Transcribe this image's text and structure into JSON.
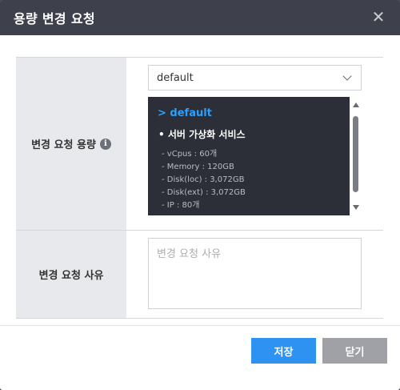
{
  "modal": {
    "title": "용량 변경 요청",
    "close_glyph": "✕"
  },
  "form": {
    "capacity_label": "변경 요청 용량",
    "info_glyph": "i",
    "select_value": "default",
    "spec": {
      "head": "> default",
      "subtitle": "• 서버 가상화 서비스",
      "items": [
        "- vCpus : 60개",
        "- Memory : 120GB",
        "- Disk(loc) : 3,072GB",
        "- Disk(ext) : 3,072GB",
        "- IP : 80개"
      ]
    },
    "reason_label": "변경 요청 사유",
    "reason_placeholder": "변경 요청 사유"
  },
  "buttons": {
    "save_label": "저장",
    "close_label": "닫기"
  },
  "colors": {
    "header_bg": "#3e414b",
    "accent": "#2e93f0",
    "spec_head": "#2aa0ff"
  },
  "icons": [
    "close-icon",
    "info-icon",
    "chevron-down-icon",
    "scroll-up-arrow-icon",
    "scroll-down-arrow-icon"
  ]
}
